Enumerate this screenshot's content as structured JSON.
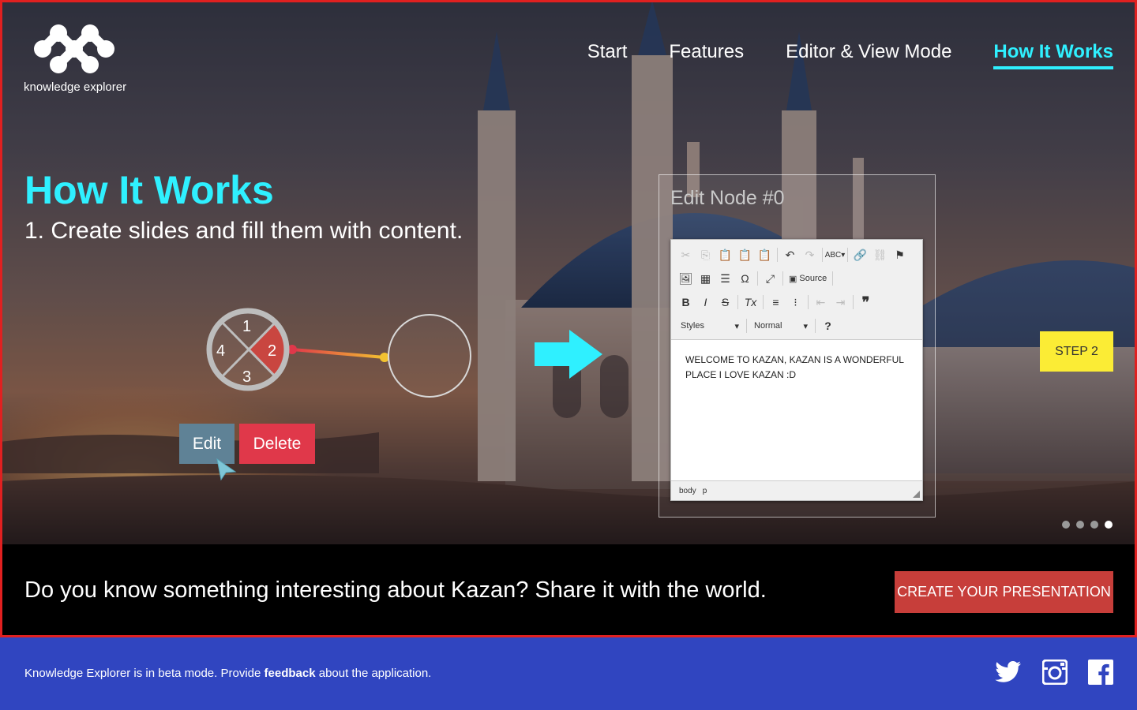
{
  "header": {
    "logo_text": "knowledge explorer",
    "nav": [
      "Start",
      "Features",
      "Editor & View Mode",
      "How It Works"
    ],
    "active_nav": "How It Works"
  },
  "hero": {
    "title": "How It Works",
    "subtitle": "1. Create slides and fill them with content.",
    "node_segments": [
      "1",
      "2",
      "3",
      "4"
    ],
    "edit_button": "Edit",
    "delete_button": "Delete",
    "step_badge": "STEP 2",
    "slides": {
      "count": 4,
      "active_index": 3
    }
  },
  "edit_panel": {
    "title": "Edit Node #0",
    "toolbar": {
      "source_label": "Source",
      "styles_label": "Styles",
      "format_label": "Normal",
      "help_label": "?"
    },
    "content": "WELCOME TO KAZAN, KAZAN IS A WONDERFUL PLACE I LOVE KAZAN :D",
    "status_path": [
      "body",
      "p"
    ]
  },
  "cta": {
    "text": "Do you know something interesting about Kazan? Share it with the world.",
    "button": "CREATE YOUR PRESENTATION"
  },
  "footer": {
    "text_before": "Knowledge Explorer is in beta mode. Provide ",
    "link": "feedback",
    "text_after": " about the application.",
    "social_icons": [
      "twitter-icon",
      "instagram-icon",
      "facebook-icon"
    ]
  },
  "colors": {
    "accent": "#2ff0ff",
    "cta_button": "#c73e3a",
    "footer_bg": "#3045c0",
    "step_badge": "#fbec35",
    "edit_button": "#5f8296",
    "delete_button": "#e0384a",
    "frame_border": "#e02020"
  }
}
